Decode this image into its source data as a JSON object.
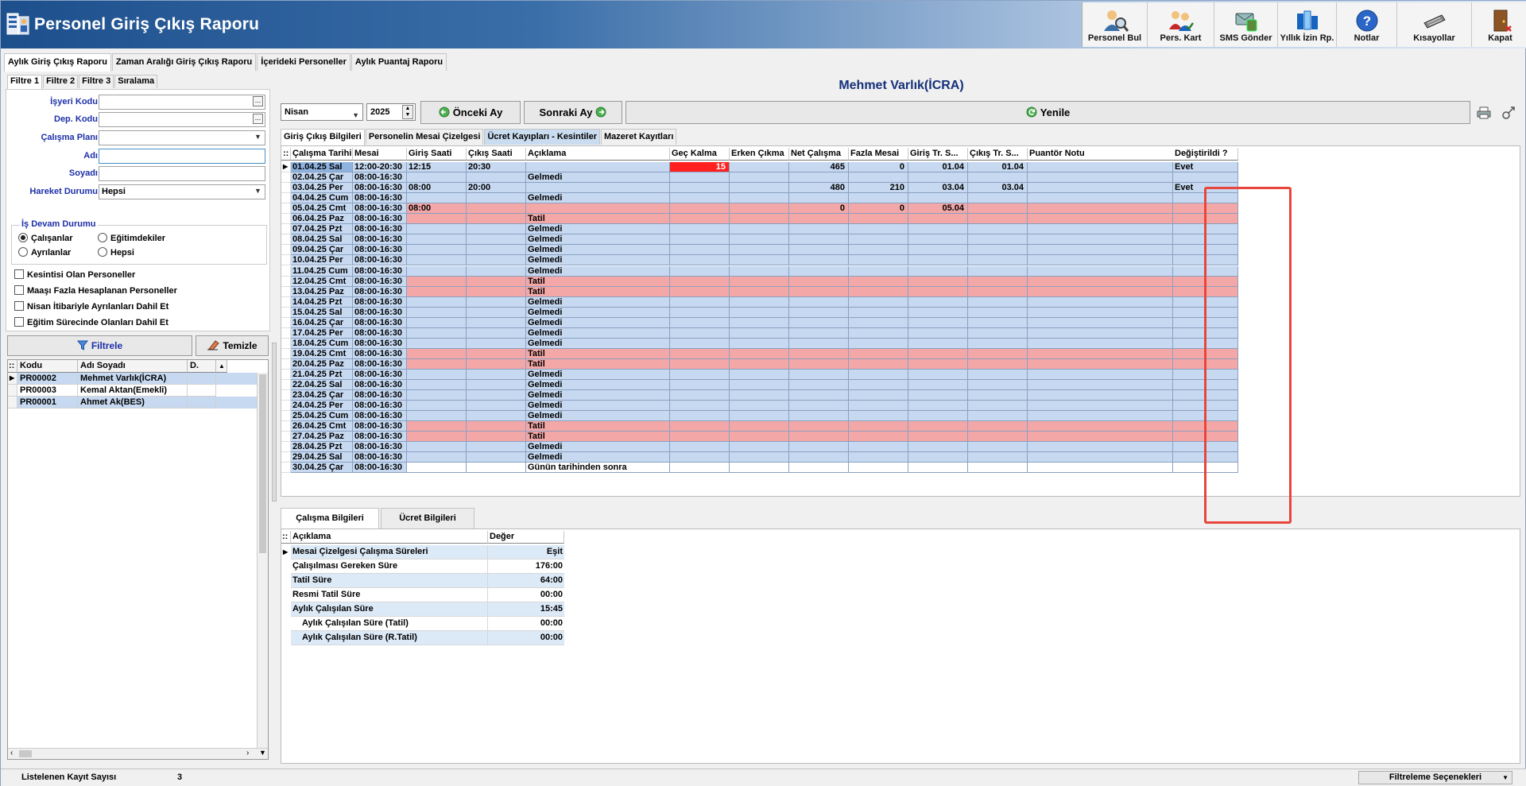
{
  "app": {
    "title": "Personel Giriş Çıkış Raporu"
  },
  "toolbar": [
    {
      "name": "personel-bul-button",
      "label": "Personel Bul",
      "icon": "person-search-icon"
    },
    {
      "name": "pers-kart-button",
      "label": "Pers. Kart",
      "icon": "person-card-icon"
    },
    {
      "name": "sms-gonder-button",
      "label": "SMS Gönder",
      "icon": "sms-icon"
    },
    {
      "name": "yillik-izin-button",
      "label": "Yıllık İzin Rp.",
      "icon": "report-icon"
    },
    {
      "name": "notlar-button",
      "label": "Notlar",
      "icon": "help-icon"
    },
    {
      "name": "kisayollar-button",
      "label": "Kısayollar",
      "icon": "keyboard-icon"
    },
    {
      "name": "kapat-button",
      "label": "Kapat",
      "icon": "exit-door-icon"
    }
  ],
  "main_tabs": [
    "Aylık Giriş Çıkış Raporu",
    "Zaman Aralığı Giriş Çıkış Raporu",
    "İçerideki Personeller",
    "Aylık Puantaj Raporu"
  ],
  "filter_tabs": [
    "Filtre 1",
    "Filtre 2",
    "Filtre 3",
    "Sıralama"
  ],
  "filters": {
    "isyeri_kodu": {
      "label": "İşyeri Kodu",
      "value": ""
    },
    "dep_kodu": {
      "label": "Dep. Kodu",
      "value": ""
    },
    "calisma_plani": {
      "label": "Çalışma Planı",
      "value": ""
    },
    "adi": {
      "label": "Adı",
      "value": ""
    },
    "soyadi": {
      "label": "Soyadı",
      "value": ""
    },
    "hareket_durumu": {
      "label": "Hareket Durumu",
      "value": "Hepsi"
    },
    "is_devam_title": "İş Devam Durumu",
    "radios": [
      "Çalışanlar",
      "Eğitimdekiler",
      "Ayrılanlar",
      "Hepsi"
    ],
    "checkboxes": [
      "Kesintisi Olan Personeller",
      "Maaşı Fazla Hesaplanan Personeller",
      "Nisan İtibariyle Ayrılanları Dahil Et",
      "Eğitim Sürecinde Olanları Dahil Et"
    ],
    "filtrele_label": "Filtrele",
    "temizle_label": "Temizle"
  },
  "person_grid": {
    "headers": [
      "Kodu",
      "Adı Soyadı",
      "D. Tari"
    ],
    "rows": [
      {
        "kod": "PR00002",
        "ad": "Mehmet Varlık(İCRA)"
      },
      {
        "kod": "PR00003",
        "ad": "Kemal Aktan(Emekli)"
      },
      {
        "kod": "PR00001",
        "ad": "Ahmet Ak(BES)"
      }
    ]
  },
  "status": {
    "label": "Listelenen Kayıt Sayısı",
    "count": "3",
    "filter_options": "Filtreleme Seçenekleri"
  },
  "right": {
    "person_title": "Mehmet Varlık(İCRA)",
    "month": "Nisan",
    "year": "2025",
    "prev_label": "Önceki Ay",
    "next_label": "Sonraki Ay",
    "refresh_label": "Yenile"
  },
  "sub_tabs": [
    "Giriş Çıkış Bilgileri",
    "Personelin Mesai Çizelgesi",
    "Ücret Kayıpları - Kesintiler",
    "Mazeret Kayıtları"
  ],
  "attendance": {
    "headers": [
      "Çalışma Tarihi",
      "Mesai",
      "Giriş Saati",
      "Çıkış Saati",
      "Açıklama",
      "Geç Kalma",
      "Erken Çıkma",
      "Net Çalışma",
      "Fazla Mesai",
      "Giriş Tr. S...",
      "Çıkış Tr. S...",
      "Puantör Notu",
      "Değiştirildi ?"
    ],
    "rows": [
      {
        "tarih": "01.04.25 Sal",
        "mesai": "12:00-20:30",
        "giris": "12:15",
        "cikis": "20:30",
        "aciklama": "",
        "gec": "15",
        "erken": "",
        "net": "465",
        "fazla": "0",
        "gtr": "01.04",
        "ctr": "01.04",
        "not": "",
        "degis": "Evet",
        "type": "work"
      },
      {
        "tarih": "02.04.25 Çar",
        "mesai": "08:00-16:30",
        "giris": "",
        "cikis": "",
        "aciklama": "Gelmedi",
        "gec": "",
        "erken": "",
        "net": "",
        "fazla": "",
        "gtr": "",
        "ctr": "",
        "not": "",
        "degis": "",
        "type": "work"
      },
      {
        "tarih": "03.04.25 Per",
        "mesai": "08:00-16:30",
        "giris": "08:00",
        "cikis": "20:00",
        "aciklama": "",
        "gec": "",
        "erken": "",
        "net": "480",
        "fazla": "210",
        "gtr": "03.04",
        "ctr": "03.04",
        "not": "",
        "degis": "Evet",
        "type": "work"
      },
      {
        "tarih": "04.04.25 Cum",
        "mesai": "08:00-16:30",
        "giris": "",
        "cikis": "",
        "aciklama": "Gelmedi",
        "gec": "",
        "erken": "",
        "net": "",
        "fazla": "",
        "gtr": "",
        "ctr": "",
        "not": "",
        "degis": "",
        "type": "work"
      },
      {
        "tarih": "05.04.25 Cmt",
        "mesai": "08:00-16:30",
        "giris": "08:00",
        "cikis": "",
        "aciklama": "",
        "gec": "",
        "erken": "",
        "net": "0",
        "fazla": "0",
        "gtr": "05.04",
        "ctr": "",
        "not": "",
        "degis": "",
        "type": "holiday"
      },
      {
        "tarih": "06.04.25 Paz",
        "mesai": "08:00-16:30",
        "giris": "",
        "cikis": "",
        "aciklama": "Tatil",
        "gec": "",
        "erken": "",
        "net": "",
        "fazla": "",
        "gtr": "",
        "ctr": "",
        "not": "",
        "degis": "",
        "type": "holiday"
      },
      {
        "tarih": "07.04.25 Pzt",
        "mesai": "08:00-16:30",
        "giris": "",
        "cikis": "",
        "aciklama": "Gelmedi",
        "gec": "",
        "erken": "",
        "net": "",
        "fazla": "",
        "gtr": "",
        "ctr": "",
        "not": "",
        "degis": "",
        "type": "work"
      },
      {
        "tarih": "08.04.25 Sal",
        "mesai": "08:00-16:30",
        "giris": "",
        "cikis": "",
        "aciklama": "Gelmedi",
        "gec": "",
        "erken": "",
        "net": "",
        "fazla": "",
        "gtr": "",
        "ctr": "",
        "not": "",
        "degis": "",
        "type": "work"
      },
      {
        "tarih": "09.04.25 Çar",
        "mesai": "08:00-16:30",
        "giris": "",
        "cikis": "",
        "aciklama": "Gelmedi",
        "gec": "",
        "erken": "",
        "net": "",
        "fazla": "",
        "gtr": "",
        "ctr": "",
        "not": "",
        "degis": "",
        "type": "work"
      },
      {
        "tarih": "10.04.25 Per",
        "mesai": "08:00-16:30",
        "giris": "",
        "cikis": "",
        "aciklama": "Gelmedi",
        "gec": "",
        "erken": "",
        "net": "",
        "fazla": "",
        "gtr": "",
        "ctr": "",
        "not": "",
        "degis": "",
        "type": "work"
      },
      {
        "tarih": "11.04.25 Cum",
        "mesai": "08:00-16:30",
        "giris": "",
        "cikis": "",
        "aciklama": "Gelmedi",
        "gec": "",
        "erken": "",
        "net": "",
        "fazla": "",
        "gtr": "",
        "ctr": "",
        "not": "",
        "degis": "",
        "type": "work"
      },
      {
        "tarih": "12.04.25 Cmt",
        "mesai": "08:00-16:30",
        "giris": "",
        "cikis": "",
        "aciklama": "Tatil",
        "gec": "",
        "erken": "",
        "net": "",
        "fazla": "",
        "gtr": "",
        "ctr": "",
        "not": "",
        "degis": "",
        "type": "holiday"
      },
      {
        "tarih": "13.04.25 Paz",
        "mesai": "08:00-16:30",
        "giris": "",
        "cikis": "",
        "aciklama": "Tatil",
        "gec": "",
        "erken": "",
        "net": "",
        "fazla": "",
        "gtr": "",
        "ctr": "",
        "not": "",
        "degis": "",
        "type": "holiday"
      },
      {
        "tarih": "14.04.25 Pzt",
        "mesai": "08:00-16:30",
        "giris": "",
        "cikis": "",
        "aciklama": "Gelmedi",
        "gec": "",
        "erken": "",
        "net": "",
        "fazla": "",
        "gtr": "",
        "ctr": "",
        "not": "",
        "degis": "",
        "type": "work"
      },
      {
        "tarih": "15.04.25 Sal",
        "mesai": "08:00-16:30",
        "giris": "",
        "cikis": "",
        "aciklama": "Gelmedi",
        "gec": "",
        "erken": "",
        "net": "",
        "fazla": "",
        "gtr": "",
        "ctr": "",
        "not": "",
        "degis": "",
        "type": "work"
      },
      {
        "tarih": "16.04.25 Çar",
        "mesai": "08:00-16:30",
        "giris": "",
        "cikis": "",
        "aciklama": "Gelmedi",
        "gec": "",
        "erken": "",
        "net": "",
        "fazla": "",
        "gtr": "",
        "ctr": "",
        "not": "",
        "degis": "",
        "type": "work"
      },
      {
        "tarih": "17.04.25 Per",
        "mesai": "08:00-16:30",
        "giris": "",
        "cikis": "",
        "aciklama": "Gelmedi",
        "gec": "",
        "erken": "",
        "net": "",
        "fazla": "",
        "gtr": "",
        "ctr": "",
        "not": "",
        "degis": "",
        "type": "work"
      },
      {
        "tarih": "18.04.25 Cum",
        "mesai": "08:00-16:30",
        "giris": "",
        "cikis": "",
        "aciklama": "Gelmedi",
        "gec": "",
        "erken": "",
        "net": "",
        "fazla": "",
        "gtr": "",
        "ctr": "",
        "not": "",
        "degis": "",
        "type": "work"
      },
      {
        "tarih": "19.04.25 Cmt",
        "mesai": "08:00-16:30",
        "giris": "",
        "cikis": "",
        "aciklama": "Tatil",
        "gec": "",
        "erken": "",
        "net": "",
        "fazla": "",
        "gtr": "",
        "ctr": "",
        "not": "",
        "degis": "",
        "type": "holiday"
      },
      {
        "tarih": "20.04.25 Paz",
        "mesai": "08:00-16:30",
        "giris": "",
        "cikis": "",
        "aciklama": "Tatil",
        "gec": "",
        "erken": "",
        "net": "",
        "fazla": "",
        "gtr": "",
        "ctr": "",
        "not": "",
        "degis": "",
        "type": "holiday"
      },
      {
        "tarih": "21.04.25 Pzt",
        "mesai": "08:00-16:30",
        "giris": "",
        "cikis": "",
        "aciklama": "Gelmedi",
        "gec": "",
        "erken": "",
        "net": "",
        "fazla": "",
        "gtr": "",
        "ctr": "",
        "not": "",
        "degis": "",
        "type": "work"
      },
      {
        "tarih": "22.04.25 Sal",
        "mesai": "08:00-16:30",
        "giris": "",
        "cikis": "",
        "aciklama": "Gelmedi",
        "gec": "",
        "erken": "",
        "net": "",
        "fazla": "",
        "gtr": "",
        "ctr": "",
        "not": "",
        "degis": "",
        "type": "work"
      },
      {
        "tarih": "23.04.25 Çar",
        "mesai": "08:00-16:30",
        "giris": "",
        "cikis": "",
        "aciklama": "Gelmedi",
        "gec": "",
        "erken": "",
        "net": "",
        "fazla": "",
        "gtr": "",
        "ctr": "",
        "not": "",
        "degis": "",
        "type": "work"
      },
      {
        "tarih": "24.04.25 Per",
        "mesai": "08:00-16:30",
        "giris": "",
        "cikis": "",
        "aciklama": "Gelmedi",
        "gec": "",
        "erken": "",
        "net": "",
        "fazla": "",
        "gtr": "",
        "ctr": "",
        "not": "",
        "degis": "",
        "type": "work"
      },
      {
        "tarih": "25.04.25 Cum",
        "mesai": "08:00-16:30",
        "giris": "",
        "cikis": "",
        "aciklama": "Gelmedi",
        "gec": "",
        "erken": "",
        "net": "",
        "fazla": "",
        "gtr": "",
        "ctr": "",
        "not": "",
        "degis": "",
        "type": "work"
      },
      {
        "tarih": "26.04.25 Cmt",
        "mesai": "08:00-16:30",
        "giris": "",
        "cikis": "",
        "aciklama": "Tatil",
        "gec": "",
        "erken": "",
        "net": "",
        "fazla": "",
        "gtr": "",
        "ctr": "",
        "not": "",
        "degis": "",
        "type": "holiday"
      },
      {
        "tarih": "27.04.25 Paz",
        "mesai": "08:00-16:30",
        "giris": "",
        "cikis": "",
        "aciklama": "Tatil",
        "gec": "",
        "erken": "",
        "net": "",
        "fazla": "",
        "gtr": "",
        "ctr": "",
        "not": "",
        "degis": "",
        "type": "holiday"
      },
      {
        "tarih": "28.04.25 Pzt",
        "mesai": "08:00-16:30",
        "giris": "",
        "cikis": "",
        "aciklama": "Gelmedi",
        "gec": "",
        "erken": "",
        "net": "",
        "fazla": "",
        "gtr": "",
        "ctr": "",
        "not": "",
        "degis": "",
        "type": "work"
      },
      {
        "tarih": "29.04.25 Sal",
        "mesai": "08:00-16:30",
        "giris": "",
        "cikis": "",
        "aciklama": "Gelmedi",
        "gec": "",
        "erken": "",
        "net": "",
        "fazla": "",
        "gtr": "",
        "ctr": "",
        "not": "",
        "degis": "",
        "type": "work"
      },
      {
        "tarih": "30.04.25 Çar",
        "mesai": "08:00-16:30",
        "giris": "",
        "cikis": "",
        "aciklama": "Günün tarihinden sonra",
        "gec": "",
        "erken": "",
        "net": "",
        "fazla": "",
        "gtr": "",
        "ctr": "",
        "not": "",
        "degis": "",
        "type": "future"
      }
    ]
  },
  "bottom_tabs": [
    "Çalışma Bilgileri",
    "Ücret Bilgileri"
  ],
  "summary": {
    "headers": [
      "Açıklama",
      "Değer"
    ],
    "rows": [
      {
        "k": "Mesai Çizelgesi Çalışma Süreleri",
        "v": "Eşit",
        "indent": false
      },
      {
        "k": "Çalışılması Gereken Süre",
        "v": "176:00",
        "indent": false
      },
      {
        "k": "Tatil Süre",
        "v": "64:00",
        "indent": false
      },
      {
        "k": "Resmi Tatil Süre",
        "v": "00:00",
        "indent": false
      },
      {
        "k": "Aylık Çalışılan Süre",
        "v": "15:45",
        "indent": false
      },
      {
        "k": "Aylık Çalışılan Süre (Tatil)",
        "v": "00:00",
        "indent": true
      },
      {
        "k": "Aylık Çalışılan Süre (R.Tatil)",
        "v": "00:00",
        "indent": true
      }
    ]
  },
  "colors": {
    "work_row": "#c6d9f1",
    "holiday_row": "#f4a7a7",
    "late_cell": "#ff2020",
    "highlight_box": "#e8453c"
  }
}
